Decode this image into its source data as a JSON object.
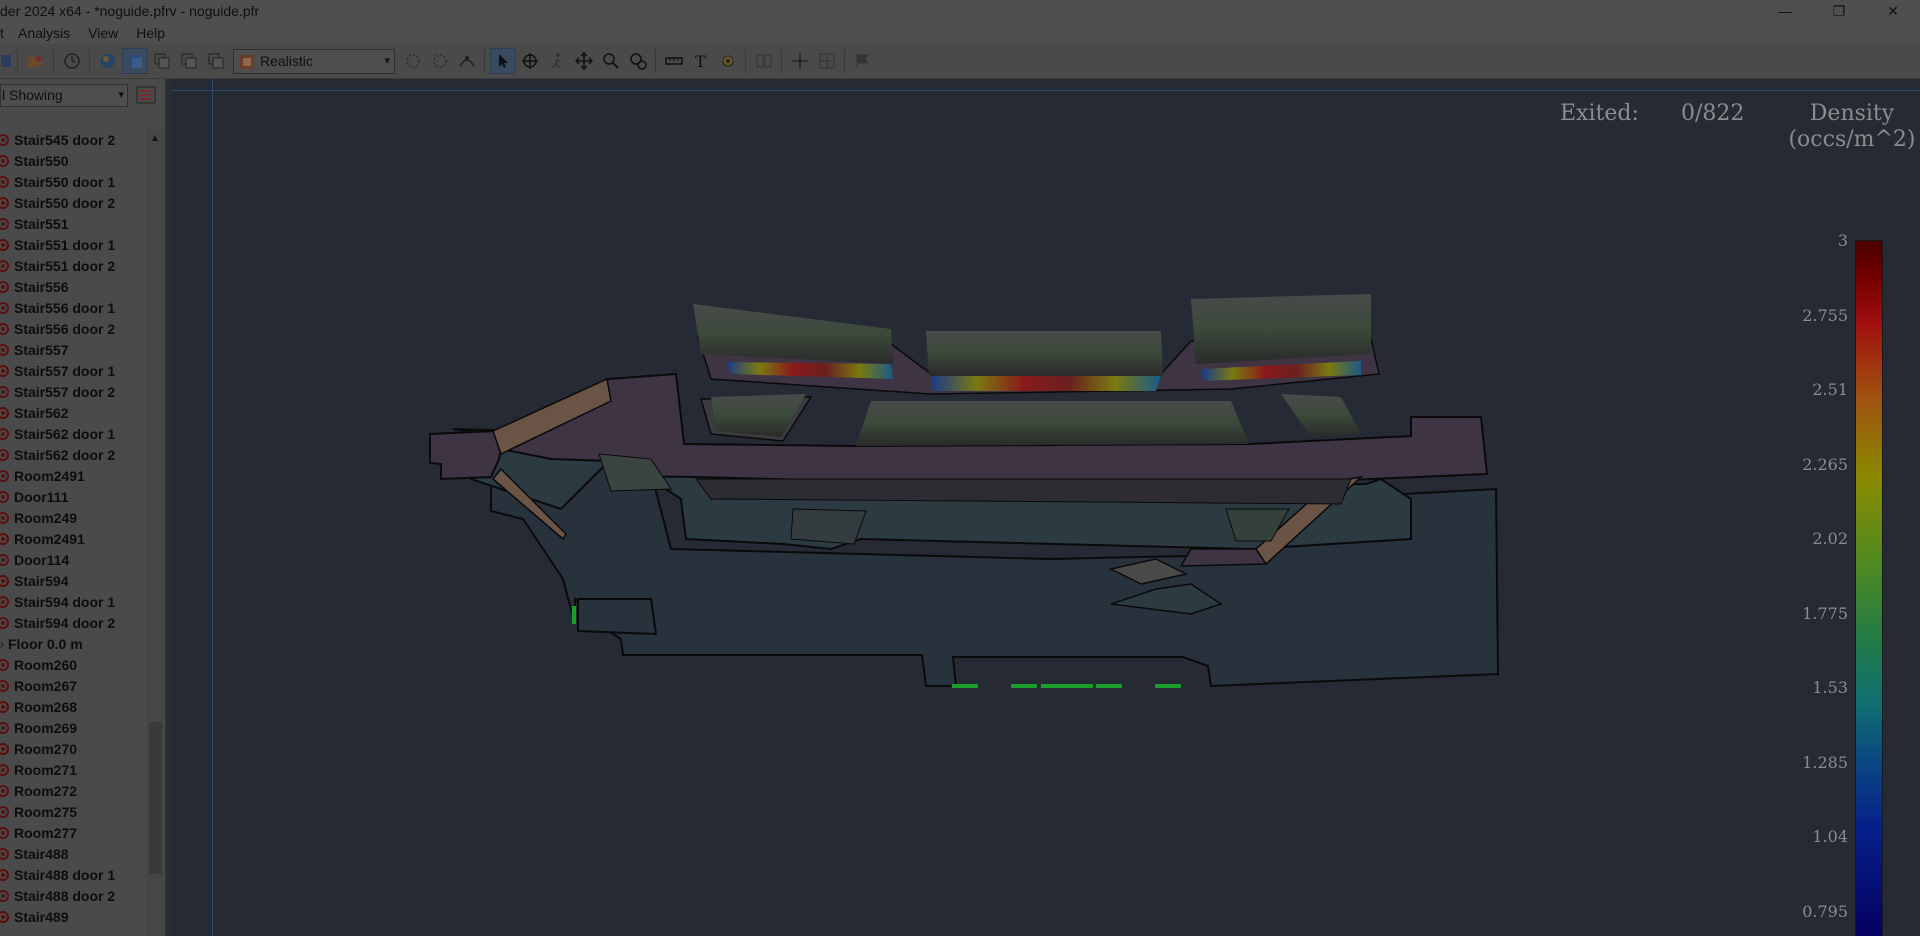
{
  "window": {
    "title": "der 2024 x64 - *noguide.pfrv - noguide.pfr",
    "controls": {
      "minimize": "—",
      "maximize": "❐",
      "close": "✕"
    }
  },
  "menu": [
    "Analysis",
    "View",
    "Help"
  ],
  "toolbar": {
    "view_mode": "Realistic",
    "icons": [
      "save-icon",
      "open-icon",
      "clock-icon",
      "globe-icon",
      "layer-icon",
      "copy-icon",
      "copy2-icon",
      "copy3-icon",
      "gear-faded-icon",
      "gear-faded2-icon",
      "path-icon",
      "select-arrow-icon",
      "orbit-icon",
      "walk-icon",
      "pan-icon",
      "zoom-icon",
      "zoom-window-icon",
      "measure-icon",
      "text-icon",
      "settings-icon",
      "align-icon",
      "crosshair-icon",
      "grid-icon",
      "flag-icon"
    ]
  },
  "sidebar": {
    "filter_label": "l Showing",
    "items": [
      {
        "label": "Stair545 door 2",
        "type": "stair"
      },
      {
        "label": "Stair550",
        "type": "stair"
      },
      {
        "label": "Stair550 door 1",
        "type": "stair"
      },
      {
        "label": "Stair550 door 2",
        "type": "stair"
      },
      {
        "label": "Stair551",
        "type": "stair"
      },
      {
        "label": "Stair551 door 1",
        "type": "stair"
      },
      {
        "label": "Stair551 door 2",
        "type": "stair"
      },
      {
        "label": "Stair556",
        "type": "stair"
      },
      {
        "label": "Stair556 door 1",
        "type": "stair"
      },
      {
        "label": "Stair556 door 2",
        "type": "stair"
      },
      {
        "label": "Stair557",
        "type": "stair"
      },
      {
        "label": "Stair557 door 1",
        "type": "stair"
      },
      {
        "label": "Stair557 door 2",
        "type": "stair"
      },
      {
        "label": "Stair562",
        "type": "stair"
      },
      {
        "label": "Stair562 door 1",
        "type": "stair"
      },
      {
        "label": "Stair562 door 2",
        "type": "stair"
      },
      {
        "label": "Room2491",
        "type": "room"
      },
      {
        "label": "Door111",
        "type": "door"
      },
      {
        "label": "Room249",
        "type": "room"
      },
      {
        "label": "Room2491",
        "type": "room"
      },
      {
        "label": "Door114",
        "type": "door"
      },
      {
        "label": "Stair594",
        "type": "stair"
      },
      {
        "label": "Stair594 door 1",
        "type": "stair"
      },
      {
        "label": "Stair594 door 2",
        "type": "stair"
      },
      {
        "label": "Floor 0.0 m",
        "type": "floor"
      },
      {
        "label": "Room260",
        "type": "room"
      },
      {
        "label": "Room267",
        "type": "room"
      },
      {
        "label": "Room268",
        "type": "room"
      },
      {
        "label": "Room269",
        "type": "room"
      },
      {
        "label": "Room270",
        "type": "room"
      },
      {
        "label": "Room271",
        "type": "room"
      },
      {
        "label": "Room272",
        "type": "room"
      },
      {
        "label": "Room275",
        "type": "room"
      },
      {
        "label": "Room277",
        "type": "room"
      },
      {
        "label": "Stair488",
        "type": "stair"
      },
      {
        "label": "Stair488 door 1",
        "type": "stair"
      },
      {
        "label": "Stair488 door 2",
        "type": "stair"
      },
      {
        "label": "Stair489",
        "type": "stair"
      }
    ]
  },
  "viewport": {
    "exited_label": "Exited:",
    "exited_value": "0/822",
    "density_title_line1": "Density",
    "density_title_line2": "(occs/m^2)",
    "legend_ticks": [
      "3",
      "2.755",
      "2.51",
      "2.265",
      "2.02",
      "1.775",
      "1.53",
      "1.285",
      "1.04",
      "0.795"
    ]
  },
  "colors": {
    "viewport_bg": "#262a34",
    "floor_dark": "#2b3540",
    "floor_purple": "#3e3444",
    "stair_tan": "#6a5446",
    "exit_green": "#1aa02a"
  }
}
